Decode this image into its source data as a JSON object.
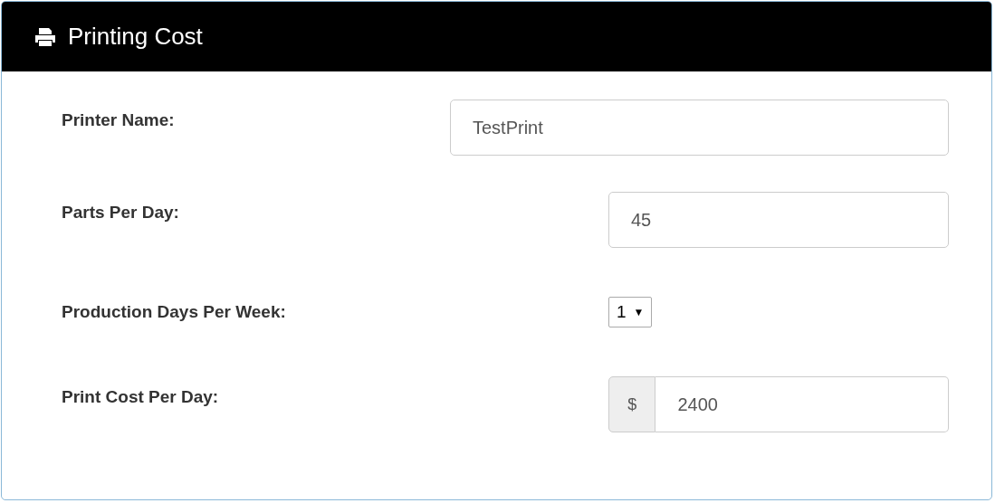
{
  "panel": {
    "title": "Printing Cost"
  },
  "fields": [
    {
      "kind": "wide_text",
      "label": "Printer Name:",
      "value": "TestPrint"
    },
    {
      "kind": "text",
      "label": "Parts Per Day:",
      "value": "45"
    },
    {
      "kind": "select",
      "label": "Production Days Per Week:",
      "value": "1",
      "arrow": "▼"
    },
    {
      "kind": "currency",
      "label": "Print Cost Per Day:",
      "prefix": "$",
      "value": "2400"
    }
  ]
}
